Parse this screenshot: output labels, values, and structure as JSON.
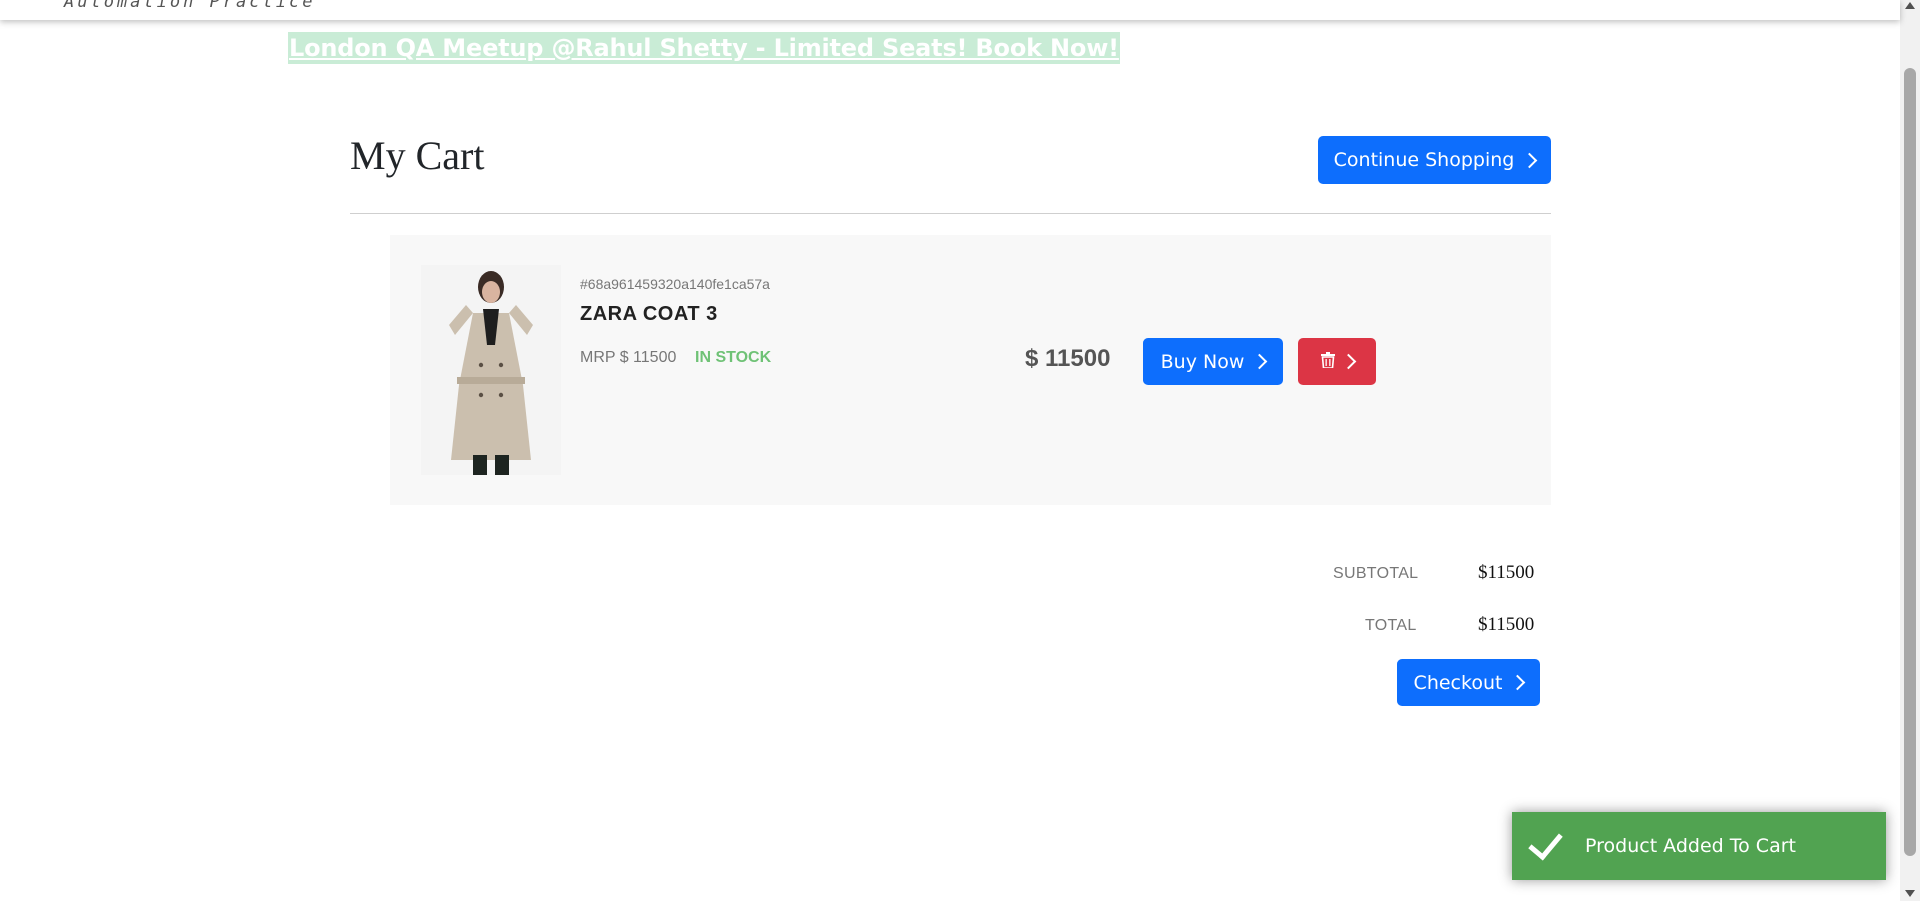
{
  "header": {
    "brand_subtitle": "Automation Practice"
  },
  "promo": {
    "text": "London QA Meetup @Rahul Shetty - Limited Seats! Book Now!"
  },
  "cart": {
    "title": "My Cart",
    "continue_label": "Continue Shopping",
    "items": [
      {
        "id": "#68a961459320a140fe1ca57a",
        "name": "ZARA COAT 3",
        "mrp": "MRP $ 11500",
        "stock": "IN STOCK",
        "price": "$ 11500",
        "buy_label": "Buy Now",
        "image_icon": "coat-product-image"
      }
    ]
  },
  "summary": {
    "subtotal_label": "SUBTOTAL",
    "subtotal_value": "$11500",
    "total_label": "TOTAL",
    "total_value": "$11500",
    "checkout_label": "Checkout"
  },
  "toast": {
    "message": "Product Added To Cart"
  },
  "colors": {
    "primary": "#0d6efd",
    "danger": "#dc3545",
    "success": "#51a351",
    "stock": "#6fc276",
    "promo_bg": "#c9ecd6"
  }
}
